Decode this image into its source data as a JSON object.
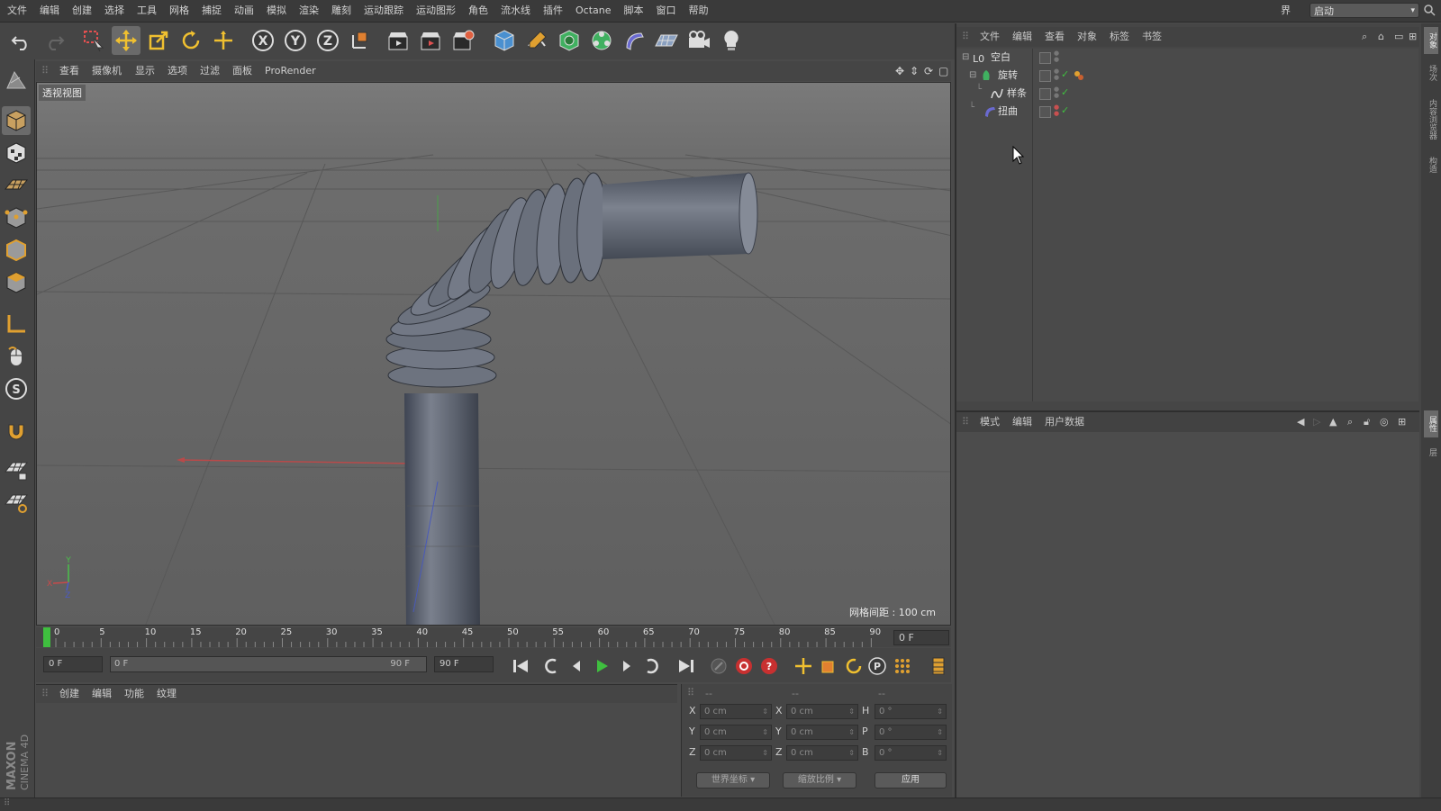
{
  "menu": [
    "文件",
    "编辑",
    "创建",
    "选择",
    "工具",
    "网格",
    "捕捉",
    "动画",
    "模拟",
    "渲染",
    "雕刻",
    "运动跟踪",
    "运动图形",
    "角色",
    "流水线",
    "插件",
    "Octane",
    "脚本",
    "窗口",
    "帮助"
  ],
  "layout": {
    "label": "界面:",
    "value": "启动"
  },
  "viewport": {
    "menu": [
      "查看",
      "摄像机",
      "显示",
      "选项",
      "过滤",
      "面板",
      "ProRender"
    ],
    "label": "透视视图",
    "grid_spacing": "网格间距 : 100 cm",
    "axis_labels": {
      "y": "Y",
      "x": "X",
      "z": "Z"
    }
  },
  "timeline": {
    "ticks": [
      "0",
      "5",
      "10",
      "15",
      "20",
      "25",
      "30",
      "35",
      "40",
      "45",
      "50",
      "55",
      "60",
      "65",
      "70",
      "75",
      "80",
      "85",
      "90"
    ],
    "current_frame": "0 F",
    "start_field": "0 F",
    "range_start": "0 F",
    "range_end": "90 F",
    "end_field": "90 F"
  },
  "material_manager": {
    "menu": [
      "创建",
      "编辑",
      "功能",
      "纹理"
    ]
  },
  "branding": {
    "line1": "MAXON",
    "line2": "CINEMA 4D"
  },
  "coordinates": {
    "header": [
      "--",
      "--",
      "--"
    ],
    "rows": [
      {
        "pos_label": "X",
        "pos_value": "0 cm",
        "size_label": "X",
        "size_value": "0 cm",
        "rot_label": "H",
        "rot_value": "0 °"
      },
      {
        "pos_label": "Y",
        "pos_value": "0 cm",
        "size_label": "Y",
        "size_value": "0 cm",
        "rot_label": "P",
        "rot_value": "0 °"
      },
      {
        "pos_label": "Z",
        "pos_value": "0 cm",
        "size_label": "Z",
        "size_value": "0 cm",
        "rot_label": "B",
        "rot_value": "0 °"
      }
    ],
    "mode_select": "世界坐标",
    "scale_select": "缩放比例",
    "apply": "应用"
  },
  "object_manager": {
    "menu": [
      "文件",
      "编辑",
      "查看",
      "对象",
      "标签",
      "书签"
    ],
    "objects": [
      {
        "name": "空白",
        "icon": "null-icon"
      },
      {
        "name": "旋转",
        "icon": "lathe-icon"
      },
      {
        "name": "样条",
        "icon": "spline-icon"
      },
      {
        "name": "扭曲",
        "icon": "bend-deformer-icon"
      }
    ]
  },
  "attribute_manager": {
    "menu": [
      "模式",
      "编辑",
      "用户数据"
    ]
  },
  "side_tabs": {
    "top": [
      "对象",
      "场次",
      "内容浏览器",
      "构造"
    ],
    "bottom": [
      "属性",
      "层"
    ]
  },
  "colors": {
    "accent_green": "#3fbf3f",
    "x_axis": "#c83c3c",
    "y_axis": "#3cc83c",
    "z_axis": "#3c5ac8",
    "selection_blue": "#4a7fc8"
  }
}
